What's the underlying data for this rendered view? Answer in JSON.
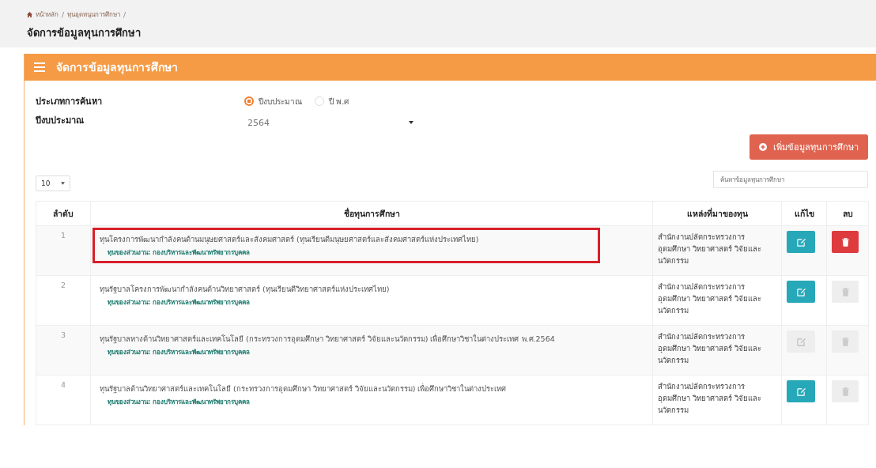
{
  "breadcrumb": [
    "หน้าหลัก",
    "ทุนอุดหนุนการศึกษา"
  ],
  "breadcrumb_separator": "/",
  "page_title": "จัดการข้อมูลทุนการศึกษา",
  "panel": {
    "title": "จัดการข้อมูลทุนการศึกษา"
  },
  "search_type": {
    "label": "ประเภทการค้นหา",
    "options": [
      {
        "label": "ปีงบประมาณ",
        "selected": true
      },
      {
        "label": "ปี พ.ศ",
        "selected": false
      }
    ]
  },
  "budget_year": {
    "label": "ปีงบประมาณ",
    "value": "2564"
  },
  "add_button": "เพิ่มข้อมูลทุนการศึกษา",
  "page_length": "10",
  "search": {
    "placeholder": "ค้นหาข้อมูลทุนการศึกษา"
  },
  "table": {
    "columns": [
      "ลำดับ",
      "ชื่อทุนการศึกษา",
      "แหล่งที่มาของทุน",
      "แก้ไข",
      "ลบ"
    ],
    "rows": [
      {
        "order": "1",
        "name": "ทุนโครงการพัฒนากำลังคนด้านมนุษยศาสตร์และสังคมศาสตร์ (ทุนเรียนดีมนุษยศาสตร์และสังคมศาสตร์แห่งประเทศไทย)",
        "unit": "ทุนของส่วนงาน: กองบริหารและพัฒนาทรัพยากรบุคคล",
        "source": "สำนักงานปลัดกระทรวงการอุดมศึกษา วิทยาศาสตร์ วิจัยและนวัตกรรม",
        "highlighted": true,
        "edit_enabled": true,
        "delete_enabled": true
      },
      {
        "order": "2",
        "name": "ทุนรัฐบาลโครงการพัฒนากำลังคนด้านวิทยาศาสตร์ (ทุนเรียนดีวิทยาศาสตร์แห่งประเทศไทย)",
        "unit": "ทุนของส่วนงาน: กองบริหารและพัฒนาทรัพยากรบุคคล",
        "source": "สำนักงานปลัดกระทรวงการอุดมศึกษา วิทยาศาสตร์ วิจัยและนวัตกรรม",
        "highlighted": false,
        "edit_enabled": true,
        "delete_enabled": false
      },
      {
        "order": "3",
        "name": "ทุนรัฐบาลทางด้านวิทยาศาสตร์และเทคโนโลยี (กระทรวงการอุดมศึกษา วิทยาศาสตร์ วิจัยและนวัตกรรม) เพื่อศึกษาวิชาในต่างประเทศ พ.ศ.2564",
        "unit": "ทุนของส่วนงาน: กองบริหารและพัฒนาทรัพยากรบุคคล",
        "source": "สำนักงานปลัดกระทรวงการอุดมศึกษา วิทยาศาสตร์ วิจัยและนวัตกรรม",
        "highlighted": false,
        "edit_enabled": false,
        "delete_enabled": false
      },
      {
        "order": "4",
        "name": "ทุนรัฐบาลด้านวิทยาศาสตร์และเทคโนโลยี (กระทรวงการอุดมศึกษา วิทยาศาสตร์ วิจัยและนวัตกรรม) เพื่อศึกษาวิชาในต่างประเทศ",
        "unit": "ทุนของส่วนงาน: กองบริหารและพัฒนาทรัพยากรบุคคล",
        "source": "สำนักงานปลัดกระทรวงการอุดมศึกษา วิทยาศาสตร์ วิจัยและนวัตกรรม",
        "highlighted": false,
        "edit_enabled": true,
        "delete_enabled": false
      }
    ]
  }
}
